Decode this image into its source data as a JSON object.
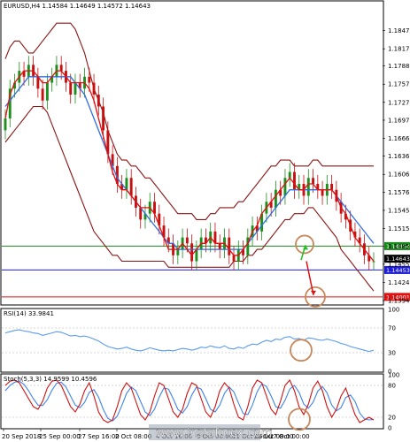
{
  "chart_data": {
    "type": "candlestick",
    "symbol_line": "EURUSD,H4  1.14584 1.14649 1.14572 1.14643",
    "price_axis": {
      "range": [
        1.1388,
        1.1896
      ],
      "ticks": [
        "1.18475",
        "1.18170",
        "1.17880",
        "1.17575",
        "1.17270",
        "1.16970",
        "1.16665",
        "1.16365",
        "1.16060",
        "1.15760",
        "1.15455",
        "1.15150",
        "1.14855",
        "1.14550",
        "1.14245",
        "1.13940"
      ]
    },
    "time_labels": [
      "20 Sep 2018",
      "25 Sep 00:00",
      "27 Sep 16:00",
      "2 Oct 08:00",
      "4 Oct 16:00",
      "9 Oct 08:00",
      "11 Oct 16:00",
      "16 Oct 08:00",
      "17 Oct 00:00"
    ],
    "close_series": [
      1.17,
      1.175,
      1.176,
      1.178,
      1.177,
      1.179,
      1.177,
      1.175,
      1.173,
      1.176,
      1.177,
      1.179,
      1.178,
      1.176,
      1.174,
      1.176,
      1.175,
      1.177,
      1.176,
      1.174,
      1.172,
      1.168,
      1.164,
      1.162,
      1.159,
      1.158,
      1.16,
      1.157,
      1.155,
      1.153,
      1.154,
      1.156,
      1.154,
      1.152,
      1.15,
      1.149,
      1.147,
      1.148,
      1.15,
      1.149,
      1.146,
      1.148,
      1.15,
      1.149,
      1.151,
      1.149,
      1.148,
      1.15,
      1.147,
      1.146,
      1.148,
      1.147,
      1.15,
      1.152,
      1.151,
      1.154,
      1.156,
      1.155,
      1.158,
      1.157,
      1.16,
      1.161,
      1.158,
      1.159,
      1.157,
      1.16,
      1.159,
      1.158,
      1.157,
      1.159,
      1.158,
      1.156,
      1.154,
      1.153,
      1.151,
      1.15,
      1.149,
      1.147,
      1.146,
      1.146
    ],
    "open_series": [
      1.168,
      1.17,
      1.175,
      1.176,
      1.178,
      1.177,
      1.179,
      1.177,
      1.175,
      1.173,
      1.176,
      1.177,
      1.179,
      1.178,
      1.176,
      1.174,
      1.176,
      1.175,
      1.177,
      1.176,
      1.174,
      1.172,
      1.168,
      1.164,
      1.162,
      1.159,
      1.158,
      1.16,
      1.157,
      1.155,
      1.153,
      1.154,
      1.156,
      1.154,
      1.152,
      1.15,
      1.149,
      1.147,
      1.148,
      1.15,
      1.149,
      1.146,
      1.148,
      1.15,
      1.149,
      1.151,
      1.149,
      1.148,
      1.15,
      1.147,
      1.146,
      1.148,
      1.147,
      1.15,
      1.152,
      1.151,
      1.154,
      1.156,
      1.155,
      1.158,
      1.157,
      1.16,
      1.161,
      1.158,
      1.159,
      1.157,
      1.16,
      1.159,
      1.158,
      1.157,
      1.159,
      1.158,
      1.156,
      1.154,
      1.153,
      1.151,
      1.15,
      1.149,
      1.147,
      1.146
    ],
    "bollinger_upper": [
      1.18,
      1.182,
      1.183,
      1.183,
      1.182,
      1.181,
      1.181,
      1.182,
      1.183,
      1.184,
      1.185,
      1.186,
      1.186,
      1.186,
      1.186,
      1.185,
      1.183,
      1.181,
      1.178,
      1.175,
      1.173,
      1.171,
      1.168,
      1.166,
      1.164,
      1.163,
      1.163,
      1.162,
      1.162,
      1.161,
      1.16,
      1.16,
      1.159,
      1.158,
      1.157,
      1.156,
      1.155,
      1.154,
      1.154,
      1.154,
      1.154,
      1.153,
      1.153,
      1.153,
      1.154,
      1.154,
      1.155,
      1.155,
      1.155,
      1.155,
      1.156,
      1.156,
      1.157,
      1.158,
      1.159,
      1.16,
      1.161,
      1.162,
      1.162,
      1.163,
      1.163,
      1.163,
      1.162,
      1.162,
      1.162,
      1.162,
      1.163,
      1.163,
      1.162,
      1.162,
      1.162,
      1.162,
      1.162,
      1.162,
      1.162,
      1.162,
      1.162,
      1.162,
      1.162,
      1.162
    ],
    "bollinger_lower": [
      1.166,
      1.167,
      1.168,
      1.169,
      1.17,
      1.171,
      1.172,
      1.172,
      1.172,
      1.171,
      1.169,
      1.167,
      1.165,
      1.163,
      1.161,
      1.159,
      1.157,
      1.155,
      1.153,
      1.151,
      1.15,
      1.149,
      1.148,
      1.147,
      1.147,
      1.146,
      1.146,
      1.146,
      1.146,
      1.146,
      1.146,
      1.146,
      1.146,
      1.146,
      1.146,
      1.145,
      1.145,
      1.145,
      1.145,
      1.145,
      1.145,
      1.145,
      1.145,
      1.145,
      1.145,
      1.145,
      1.145,
      1.145,
      1.145,
      1.146,
      1.146,
      1.146,
      1.147,
      1.147,
      1.148,
      1.148,
      1.149,
      1.15,
      1.151,
      1.152,
      1.153,
      1.153,
      1.154,
      1.154,
      1.154,
      1.155,
      1.155,
      1.154,
      1.153,
      1.152,
      1.151,
      1.15,
      1.148,
      1.147,
      1.146,
      1.145,
      1.144,
      1.143,
      1.142,
      1.141
    ],
    "moving_average_blue": [
      1.172,
      1.173,
      1.174,
      1.175,
      1.176,
      1.177,
      1.177,
      1.177,
      1.177,
      1.177,
      1.177,
      1.177,
      1.177,
      1.177,
      1.177,
      1.176,
      1.175,
      1.174,
      1.172,
      1.17,
      1.168,
      1.166,
      1.164,
      1.162,
      1.16,
      1.159,
      1.158,
      1.157,
      1.156,
      1.155,
      1.154,
      1.153,
      1.152,
      1.151,
      1.15,
      1.149,
      1.149,
      1.148,
      1.148,
      1.148,
      1.148,
      1.148,
      1.148,
      1.148,
      1.148,
      1.148,
      1.148,
      1.148,
      1.148,
      1.148,
      1.148,
      1.148,
      1.149,
      1.15,
      1.151,
      1.152,
      1.153,
      1.154,
      1.155,
      1.156,
      1.157,
      1.158,
      1.158,
      1.158,
      1.158,
      1.158,
      1.158,
      1.158,
      1.158,
      1.158,
      1.158,
      1.157,
      1.156,
      1.155,
      1.154,
      1.153,
      1.152,
      1.151,
      1.15,
      1.149
    ],
    "moving_average_red": [
      1.17,
      1.174,
      1.176,
      1.177,
      1.178,
      1.178,
      1.178,
      1.177,
      1.176,
      1.176,
      1.177,
      1.178,
      1.178,
      1.177,
      1.176,
      1.176,
      1.176,
      1.176,
      1.175,
      1.173,
      1.17,
      1.167,
      1.164,
      1.161,
      1.159,
      1.158,
      1.158,
      1.157,
      1.156,
      1.155,
      1.155,
      1.155,
      1.154,
      1.152,
      1.15,
      1.148,
      1.148,
      1.148,
      1.149,
      1.148,
      1.147,
      1.148,
      1.149,
      1.149,
      1.15,
      1.149,
      1.149,
      1.149,
      1.148,
      1.147,
      1.147,
      1.148,
      1.149,
      1.151,
      1.152,
      1.154,
      1.155,
      1.156,
      1.157,
      1.158,
      1.159,
      1.16,
      1.159,
      1.158,
      1.158,
      1.159,
      1.159,
      1.158,
      1.158,
      1.158,
      1.158,
      1.157,
      1.155,
      1.154,
      1.152,
      1.15,
      1.149,
      1.148,
      1.147,
      1.146
    ],
    "horizontal_levels": [
      {
        "value": 1.14854,
        "label": "1.14854",
        "color": "#1a8a1a"
      },
      {
        "value": 1.14643,
        "label": "1.14643",
        "color": "#000000"
      },
      {
        "value": 1.14453,
        "label": "1.14453",
        "color": "#1d1dd8"
      },
      {
        "value": 1.14001,
        "label": "1.14001",
        "color": "#e01010"
      }
    ],
    "rsi": {
      "title": "RSI(14) 33.9841",
      "ticks": [
        "100",
        "70",
        "30",
        "0"
      ],
      "values": [
        62,
        64,
        66,
        67,
        65,
        64,
        62,
        61,
        58,
        60,
        62,
        64,
        63,
        60,
        57,
        58,
        56,
        57,
        55,
        52,
        49,
        44,
        40,
        38,
        36,
        37,
        39,
        36,
        34,
        33,
        35,
        38,
        36,
        34,
        33,
        34,
        33,
        35,
        37,
        36,
        34,
        36,
        39,
        38,
        41,
        39,
        38,
        41,
        37,
        36,
        39,
        37,
        41,
        44,
        43,
        47,
        50,
        48,
        52,
        51,
        55,
        56,
        52,
        53,
        50,
        54,
        53,
        51,
        50,
        52,
        50,
        48,
        45,
        43,
        40,
        38,
        36,
        34,
        32,
        34
      ]
    },
    "stochastic": {
      "title": "Stoch(5,3,3) 14.9599 10.4596",
      "ticks": [
        "100",
        "80",
        "20",
        "0"
      ],
      "k_values": [
        80,
        88,
        90,
        85,
        70,
        55,
        40,
        35,
        50,
        75,
        88,
        90,
        80,
        60,
        40,
        30,
        45,
        70,
        85,
        60,
        30,
        15,
        10,
        15,
        40,
        70,
        85,
        75,
        50,
        25,
        15,
        30,
        60,
        85,
        80,
        55,
        30,
        20,
        35,
        65,
        85,
        80,
        55,
        30,
        20,
        40,
        70,
        85,
        75,
        45,
        20,
        15,
        40,
        75,
        90,
        85,
        60,
        35,
        25,
        50,
        80,
        90,
        70,
        40,
        25,
        45,
        75,
        88,
        70,
        40,
        20,
        35,
        60,
        75,
        50,
        25,
        10,
        15,
        20,
        15
      ],
      "d_values": [
        70,
        80,
        86,
        88,
        82,
        70,
        55,
        43,
        42,
        53,
        71,
        84,
        86,
        77,
        60,
        43,
        38,
        48,
        67,
        72,
        58,
        35,
        18,
        13,
        22,
        42,
        65,
        77,
        70,
        50,
        30,
        23,
        35,
        58,
        75,
        73,
        55,
        35,
        28,
        40,
        62,
        77,
        73,
        55,
        35,
        30,
        43,
        65,
        77,
        68,
        47,
        27,
        25,
        43,
        68,
        83,
        78,
        60,
        40,
        37,
        52,
        73,
        80,
        67,
        45,
        37,
        48,
        69,
        78,
        66,
        43,
        32,
        38,
        57,
        62,
        50,
        28,
        17,
        15,
        16
      ]
    },
    "watermark": "www.instaforex.com",
    "colors": {
      "candle_up": "#1e8f1e",
      "candle_down": "#c81010",
      "bollinger": "#8b1414",
      "ma_blue": "#2f6fe0",
      "ma_red": "#e01010",
      "rsi_line": "#5a9af0",
      "stoch_k": "#d01010",
      "stoch_d": "#3f83ea",
      "circle": "#c8875a",
      "arrow_green": "#1fbf1f",
      "arrow_red": "#e01010"
    }
  }
}
